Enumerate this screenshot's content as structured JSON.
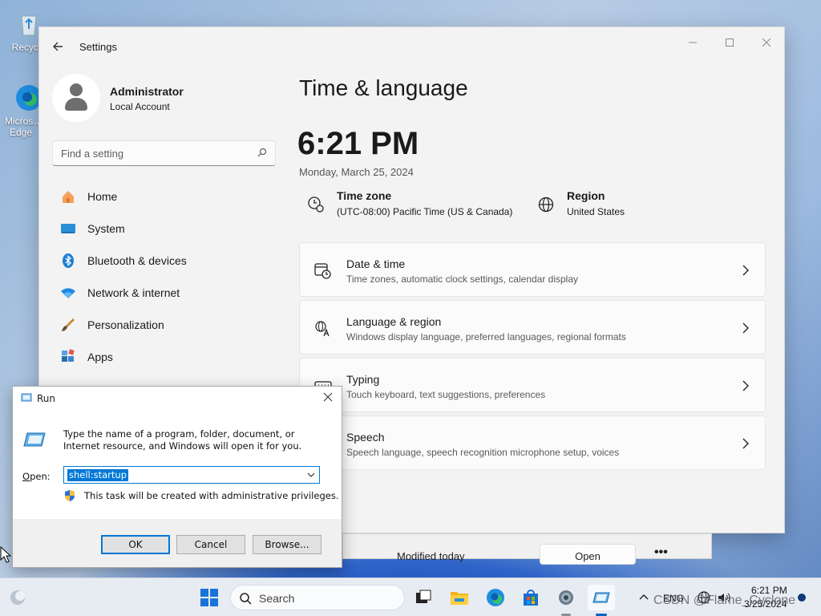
{
  "desktop": {
    "icons": [
      {
        "label": "Recycle",
        "icon": "recycle-bin-icon"
      },
      {
        "label": "Micros… Edge",
        "icon": "edge-icon"
      }
    ]
  },
  "settings": {
    "window_title": "Settings",
    "profile": {
      "name": "Administrator",
      "account_type": "Local Account"
    },
    "search": {
      "placeholder": "Find a setting"
    },
    "nav": [
      {
        "label": "Home",
        "icon": "home-icon"
      },
      {
        "label": "System",
        "icon": "system-icon"
      },
      {
        "label": "Bluetooth & devices",
        "icon": "bluetooth-icon"
      },
      {
        "label": "Network & internet",
        "icon": "network-icon"
      },
      {
        "label": "Personalization",
        "icon": "brush-icon"
      },
      {
        "label": "Apps",
        "icon": "apps-icon"
      }
    ],
    "page_title": "Time & language",
    "clock": "6:21 PM",
    "date": "Monday, March 25, 2024",
    "time_zone": {
      "title": "Time zone",
      "value": "(UTC-08:00) Pacific Time (US & Canada)"
    },
    "region": {
      "title": "Region",
      "value": "United States"
    },
    "cards": [
      {
        "title": "Date & time",
        "subtitle": "Time zones, automatic clock settings, calendar display",
        "icon": "date-time-icon"
      },
      {
        "title": "Language & region",
        "subtitle": "Windows display language, preferred languages, regional formats",
        "icon": "language-icon"
      },
      {
        "title": "Typing",
        "subtitle": "Touch keyboard, text suggestions, preferences",
        "icon": "keyboard-icon"
      },
      {
        "title": "Speech",
        "subtitle": "Speech language, speech recognition microphone setup, voices",
        "icon": "speech-icon"
      }
    ]
  },
  "background_window": {
    "modified": "Modified today",
    "open_label": "Open",
    "more": "•••"
  },
  "run_dialog": {
    "title": "Run",
    "description": "Type the name of a program, folder, document, or Internet resource, and Windows will open it for you.",
    "open_label": "Open:",
    "open_value": "shell:startup",
    "admin_note": "This task will be created with administrative privileges.",
    "ok": "OK",
    "cancel": "Cancel",
    "browse": "Browse..."
  },
  "taskbar": {
    "search_label": "Search",
    "language": "ENG",
    "time": "6:21 PM",
    "date": "3/25/2024",
    "accent": "#0067c0"
  },
  "watermark": "CSDN @Flame_Cyclone"
}
